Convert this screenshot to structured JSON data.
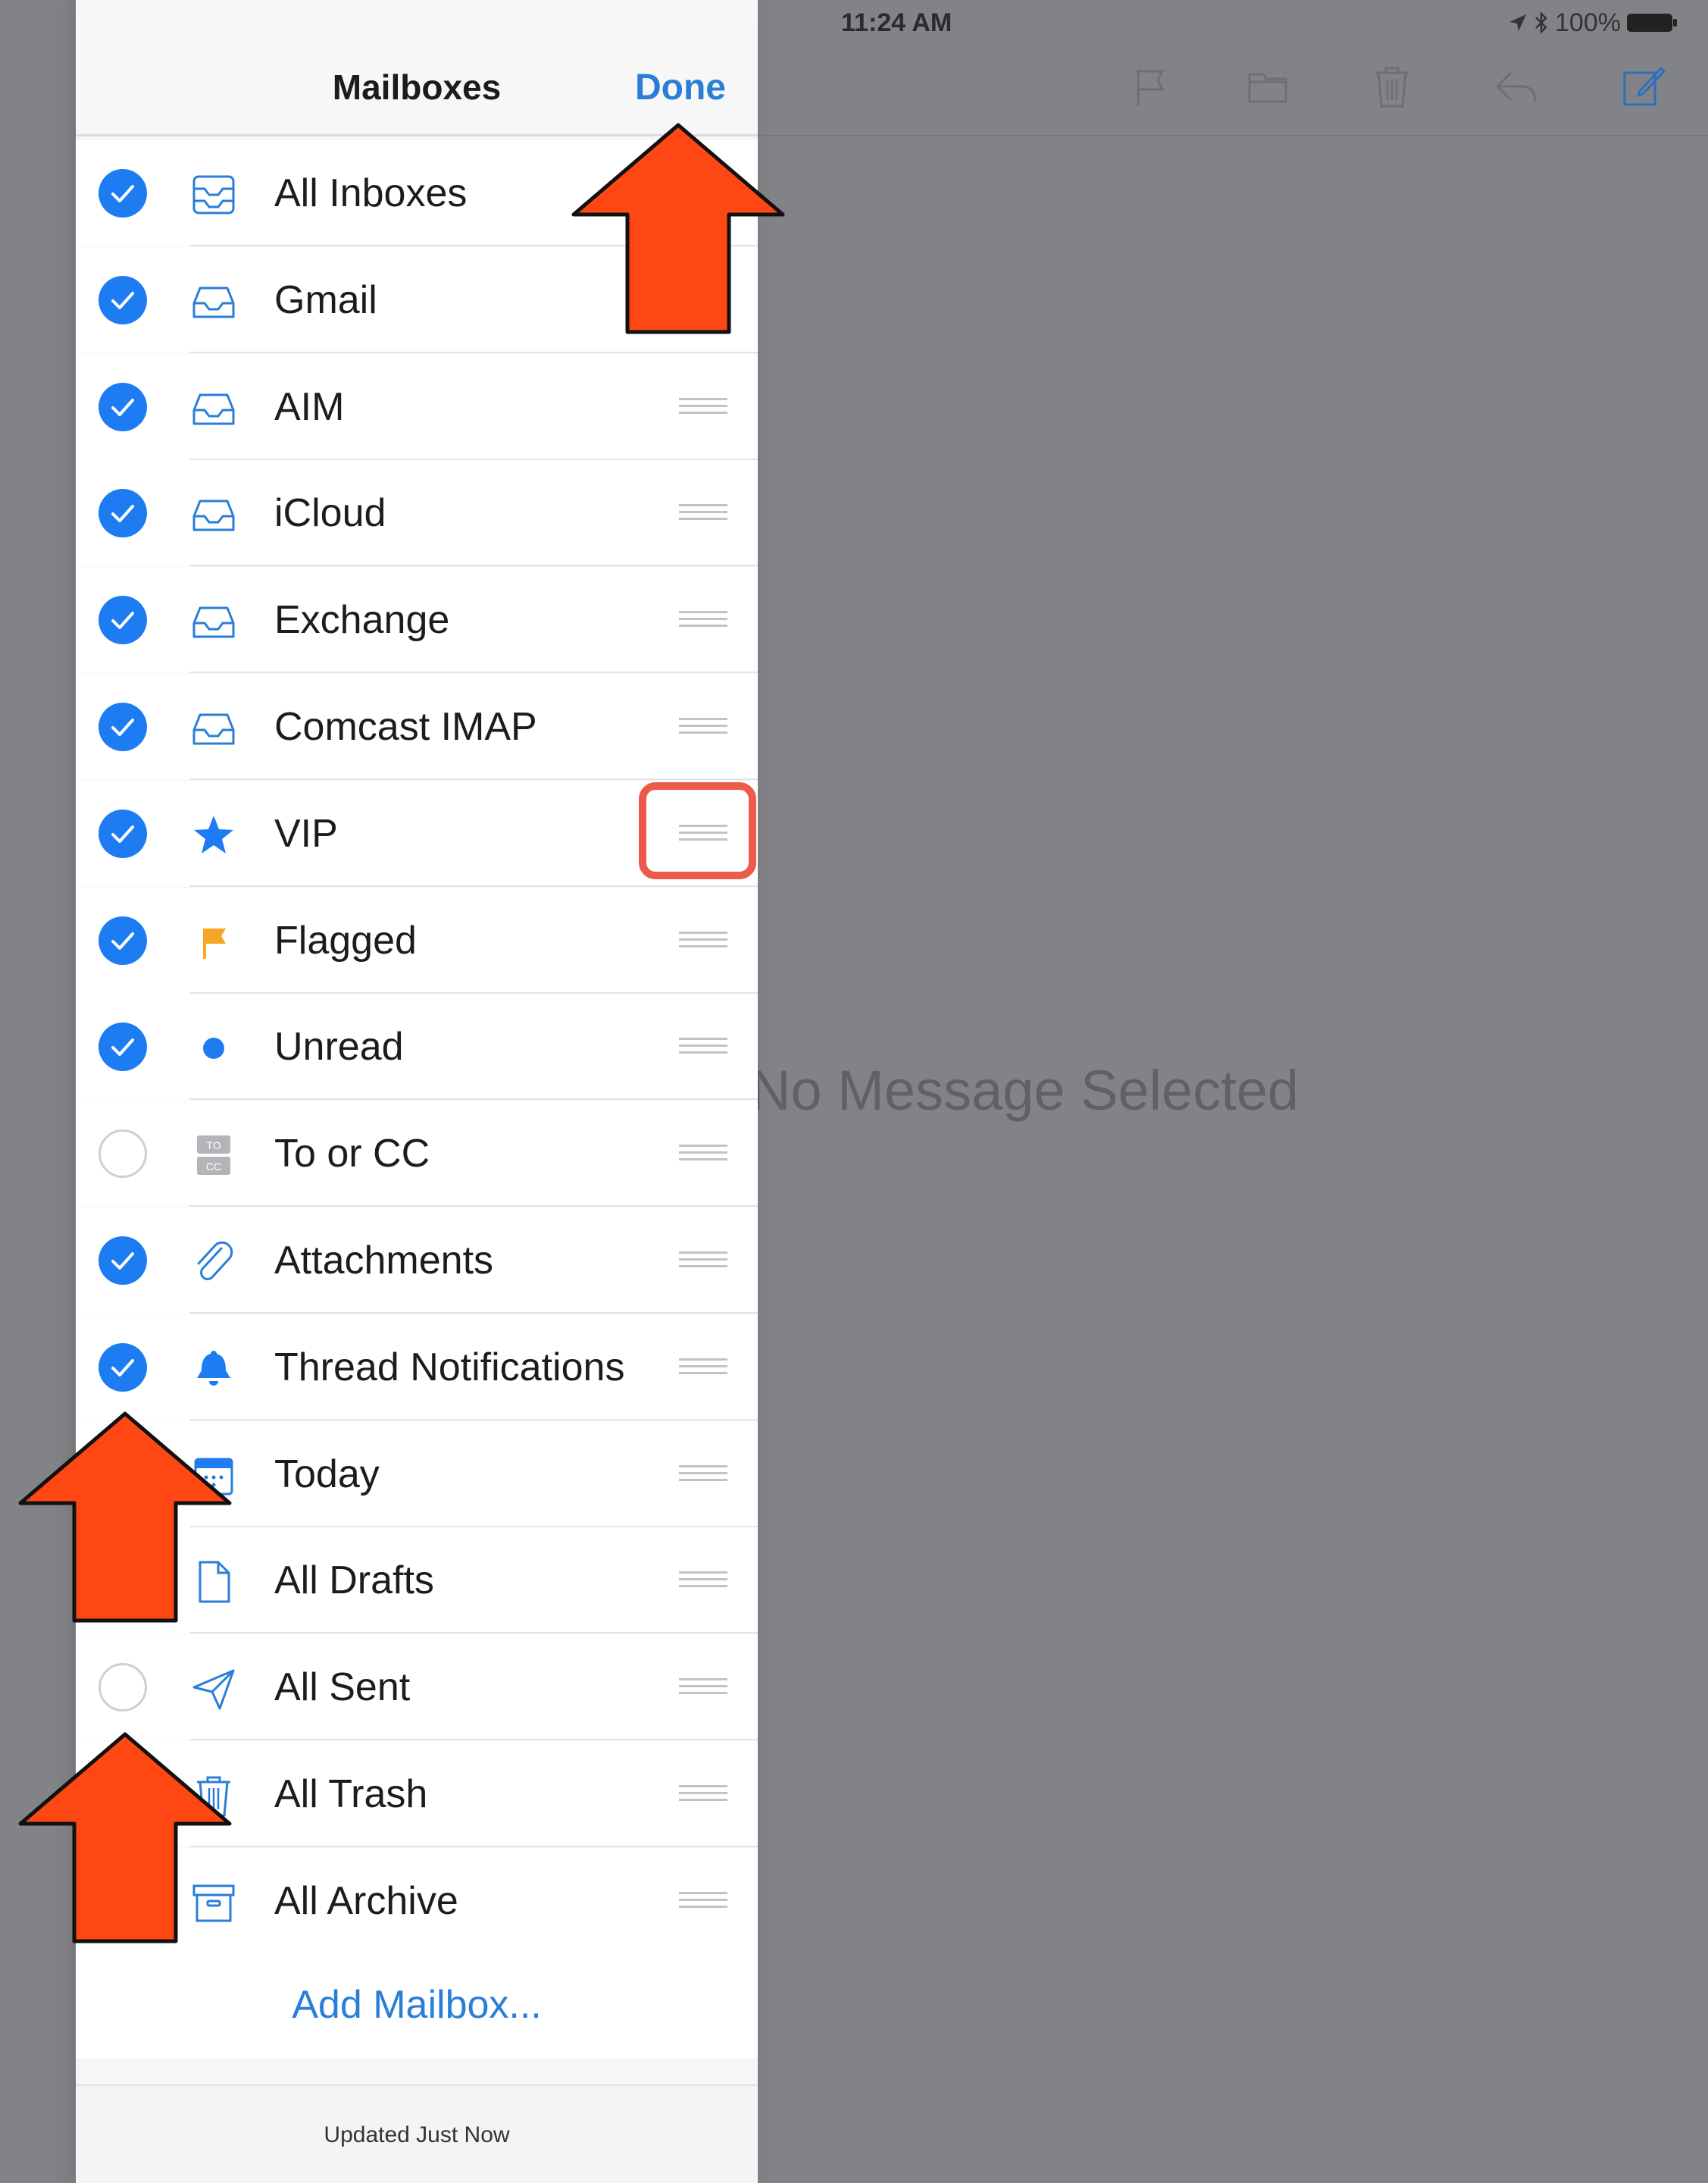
{
  "status_bar": {
    "device": "iPad",
    "time": "11:24 AM",
    "battery": "100%"
  },
  "detail": {
    "empty_text": "No Message Selected",
    "toolbar": [
      "flag-icon",
      "folder-icon",
      "trash-icon",
      "reply-icon",
      "compose-icon"
    ]
  },
  "sidebar": {
    "title": "Mailboxes",
    "done_label": "Done",
    "items": [
      {
        "label": "All Inboxes",
        "checked": true,
        "icon": "all-inboxes-icon"
      },
      {
        "label": "Gmail",
        "checked": true,
        "icon": "inbox-icon"
      },
      {
        "label": "AIM",
        "checked": true,
        "icon": "inbox-icon"
      },
      {
        "label": "iCloud",
        "checked": true,
        "icon": "inbox-icon"
      },
      {
        "label": "Exchange",
        "checked": true,
        "icon": "inbox-icon"
      },
      {
        "label": "Comcast IMAP",
        "checked": true,
        "icon": "inbox-icon"
      },
      {
        "label": "VIP",
        "checked": true,
        "icon": "star-icon"
      },
      {
        "label": "Flagged",
        "checked": true,
        "icon": "flag-icon"
      },
      {
        "label": "Unread",
        "checked": true,
        "icon": "unread-dot-icon"
      },
      {
        "label": "To or CC",
        "checked": false,
        "icon": "to-cc-icon",
        "icon_text": [
          "TO",
          "CC"
        ]
      },
      {
        "label": "Attachments",
        "checked": true,
        "icon": "paperclip-icon"
      },
      {
        "label": "Thread Notifications",
        "checked": true,
        "icon": "bell-icon"
      },
      {
        "label": "Today",
        "checked": true,
        "icon": "calendar-icon"
      },
      {
        "label": "All Drafts",
        "checked": true,
        "icon": "document-icon"
      },
      {
        "label": "All Sent",
        "checked": false,
        "icon": "paper-plane-icon"
      },
      {
        "label": "All Trash",
        "checked": true,
        "icon": "trash-icon"
      },
      {
        "label": "All Archive",
        "checked": true,
        "icon": "archive-icon"
      }
    ],
    "add_mailbox_label": "Add Mailbox...",
    "footer": "Updated Just Now"
  },
  "colors": {
    "accent": "#1d7cf2",
    "link": "#2a7ed8",
    "flag": "#f5a623",
    "annotation_arrow": "#ff4713",
    "annotation_box": "#ec5a4a"
  }
}
